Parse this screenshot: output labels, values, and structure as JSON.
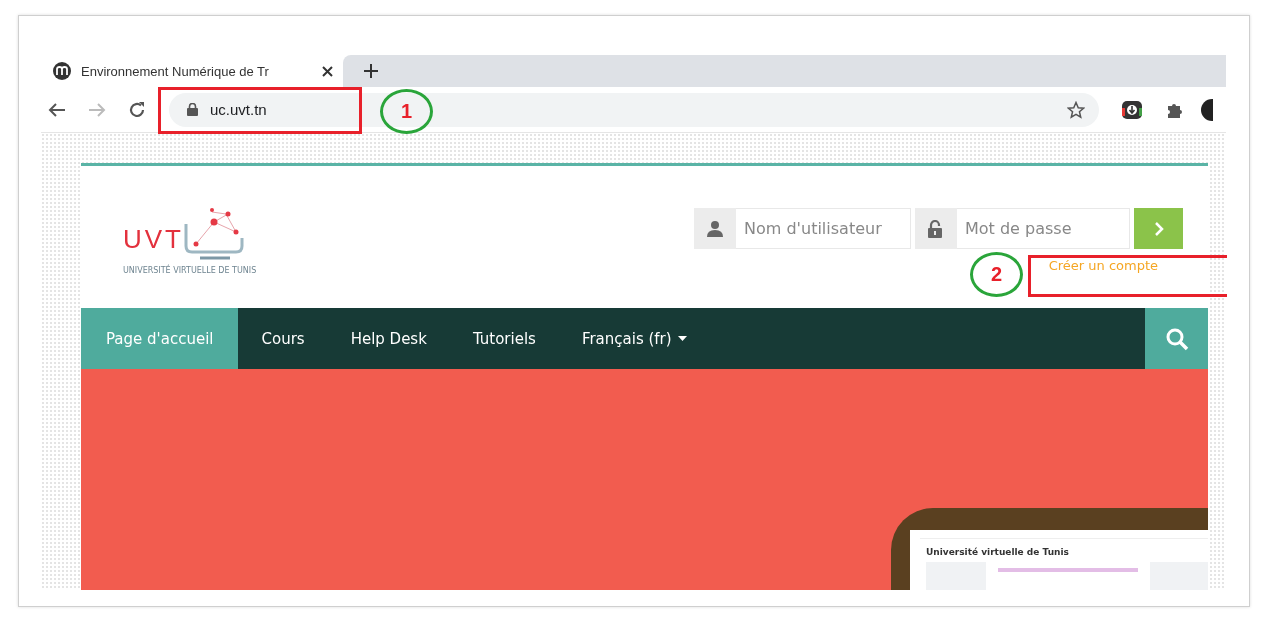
{
  "browser": {
    "tabs": [
      {
        "title": "Environnement Numérique de Tr",
        "selected": true
      }
    ],
    "address": "uc.uvt.tn"
  },
  "site": {
    "logo": {
      "wordmark": "UVT",
      "subtitle": "UNIVERSITÉ VIRTUELLE DE TUNIS"
    },
    "login": {
      "username_placeholder": "Nom d'utilisateur",
      "password_placeholder": "Mot de passe",
      "signup_link": "Créer un compte"
    },
    "nav": [
      {
        "label": "Page d'accueil",
        "selected": true,
        "dropdown": false
      },
      {
        "label": "Cours",
        "selected": false,
        "dropdown": false
      },
      {
        "label": "Help Desk",
        "selected": false,
        "dropdown": false
      },
      {
        "label": "Tutoriels",
        "selected": false,
        "dropdown": false
      },
      {
        "label": "Français (fr)",
        "selected": false,
        "dropdown": true
      }
    ],
    "hero": {
      "preview_title": "Université virtuelle de Tunis"
    }
  },
  "annotations": [
    {
      "number": "1"
    },
    {
      "number": "2"
    }
  ]
}
